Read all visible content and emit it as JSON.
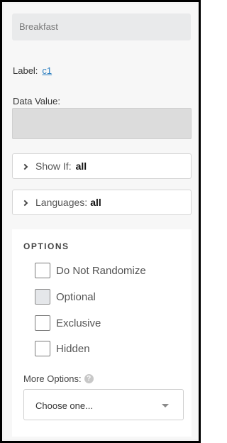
{
  "item": {
    "name": "Breakfast"
  },
  "label": {
    "caption": "Label:",
    "value": "c1"
  },
  "data_value": {
    "caption": "Data Value:",
    "value": ""
  },
  "show_if": {
    "caption": "Show If:",
    "value": "all"
  },
  "languages": {
    "caption": "Languages:",
    "value": "all"
  },
  "options": {
    "title": "OPTIONS",
    "items": [
      {
        "label": "Do Not Randomize",
        "checked": false
      },
      {
        "label": "Optional",
        "checked": false
      },
      {
        "label": "Exclusive",
        "checked": false
      },
      {
        "label": "Hidden",
        "checked": false
      }
    ],
    "more_options_label": "More Options:",
    "more_options_placeholder": "Choose one..."
  }
}
